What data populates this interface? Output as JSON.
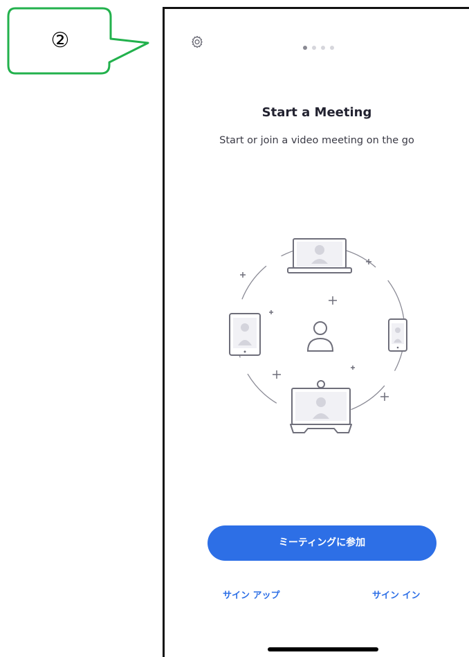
{
  "annotation": {
    "label": "②",
    "color": "#22b14c"
  },
  "header": {
    "settings_icon": "gear-icon",
    "page_dots": {
      "count": 4,
      "active_index": 0
    }
  },
  "main": {
    "title": "Start a Meeting",
    "subtitle": "Start or join a video meeting on the go",
    "illustration": "meeting-devices-illustration"
  },
  "actions": {
    "join_label": "ミーティングに参加",
    "signup_label": "サイン アップ",
    "signin_label": "サイン イン"
  },
  "colors": {
    "accent": "#2d6fe6",
    "annotation_green": "#22b14c"
  }
}
